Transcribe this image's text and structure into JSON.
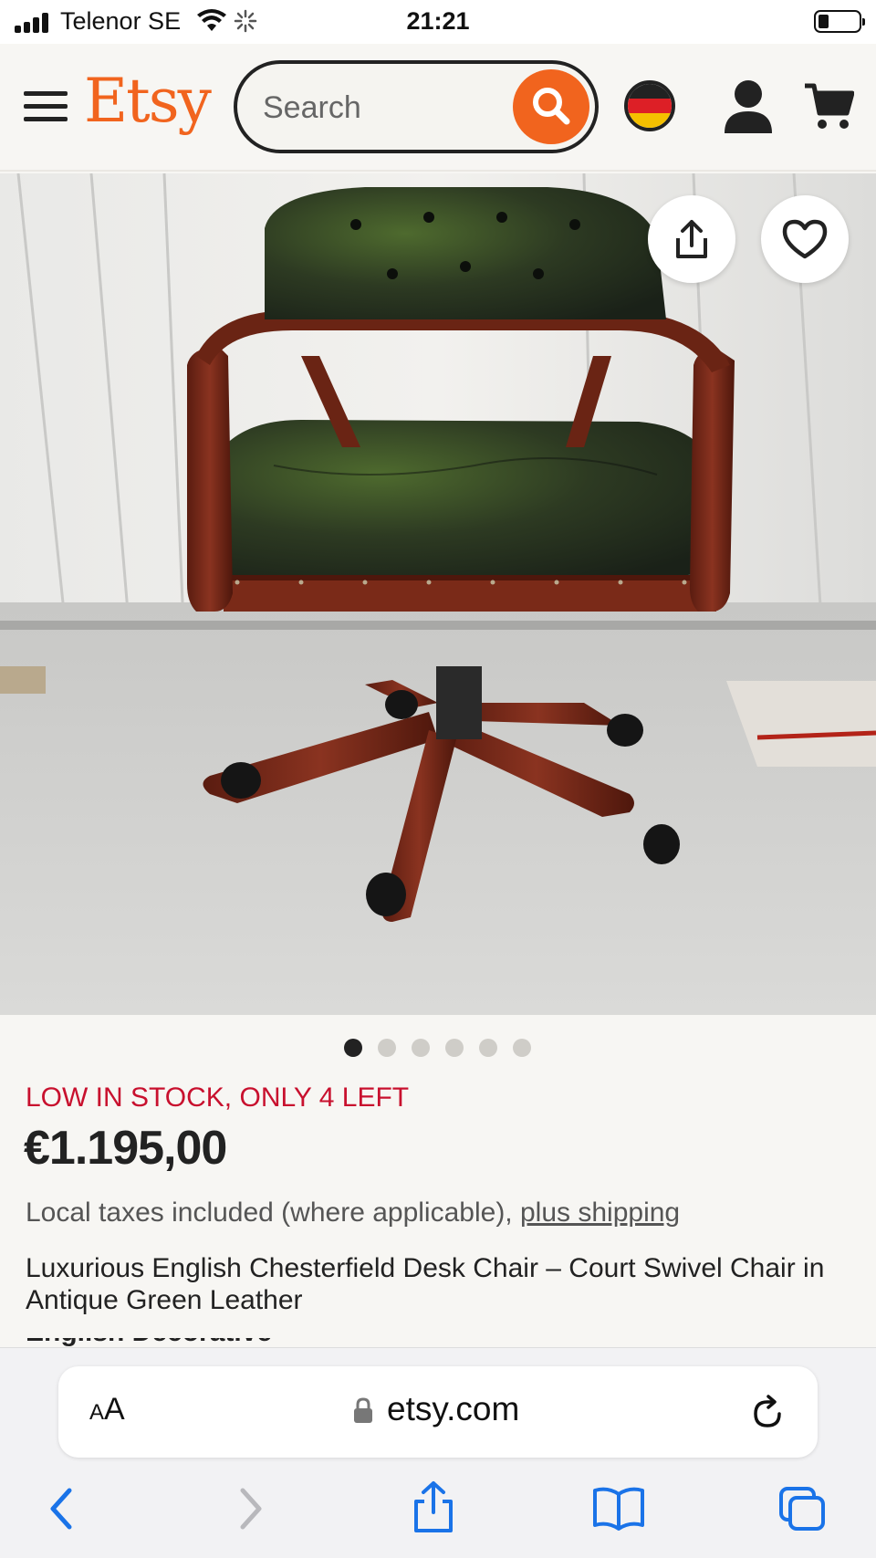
{
  "status_bar": {
    "carrier": "Telenor SE",
    "time": "21:21"
  },
  "header": {
    "logo": "Etsy",
    "search_placeholder": "Search"
  },
  "gallery": {
    "image_description": "Chesterfield swivel desk chair in green leather",
    "dot_count": 6,
    "active_index": 0
  },
  "product": {
    "stock_notice": "LOW IN STOCK, ONLY 4 LEFT",
    "price": "€1.195,00",
    "tax_text": "Local taxes included (where applicable), ",
    "shipping_link": "plus shipping",
    "title": "Luxurious English Chesterfield Desk Chair – Court Swivel Chair in Antique Green Leather",
    "shop_name_partial": "English Decorative"
  },
  "browser": {
    "text_size_label": "AA",
    "url": "etsy.com"
  },
  "colors": {
    "brand": "#f1641e",
    "stock_alert": "#c8102e",
    "ios_blue": "#1a73e8"
  }
}
